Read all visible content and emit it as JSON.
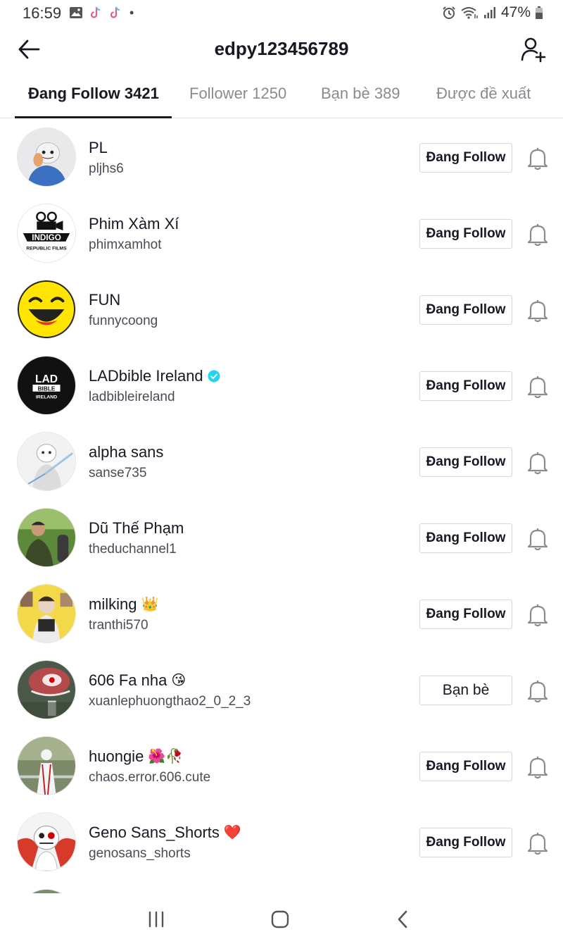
{
  "status_bar": {
    "time": "16:59",
    "dot": "•",
    "battery": "47%",
    "icons": [
      "image-icon",
      "tiktok-icon",
      "tiktok-icon",
      "alarm-icon",
      "wifi-icon",
      "signal-icon",
      "battery-icon"
    ]
  },
  "header": {
    "title": "edpy123456789"
  },
  "tabs": [
    {
      "label": "Đang Follow 3421",
      "active": true
    },
    {
      "label": "Follower 1250",
      "active": false
    },
    {
      "label": "Bạn bè 389",
      "active": false
    },
    {
      "label": "Được đề xuất",
      "active": false
    }
  ],
  "users": [
    {
      "name": "PL",
      "username": "pljhs6",
      "button": "Đang Follow",
      "emoji": ""
    },
    {
      "name": "Phim Xàm Xí",
      "username": "phimxamhot",
      "button": "Đang Follow",
      "emoji": ""
    },
    {
      "name": "FUN",
      "username": "funnycoong",
      "button": "Đang Follow",
      "emoji": ""
    },
    {
      "name": "LADbible Ireland",
      "username": "ladbibleireland",
      "button": "Đang Follow",
      "emoji": "",
      "verified": true
    },
    {
      "name": "alpha sans",
      "username": "sanse735",
      "button": "Đang Follow",
      "emoji": ""
    },
    {
      "name": "Dũ Thế Phạm",
      "username": "theduchannel1",
      "button": "Đang Follow",
      "emoji": ""
    },
    {
      "name": "milking",
      "username": "tranthi570",
      "button": "Đang Follow",
      "emoji": "👑"
    },
    {
      "name": "606 Fa nha",
      "username": "xuanlephuongthao2_0_2_3",
      "button": "Bạn bè",
      "emoji": "😘"
    },
    {
      "name": "huongie",
      "username": "chaos.error.606.cute",
      "button": "Đang Follow",
      "emoji": "🌺🥀"
    },
    {
      "name": "Geno Sans_Shorts",
      "username": "genosans_shorts",
      "button": "Đang Follow",
      "emoji": "❤️"
    }
  ],
  "avatars": {
    "pl": "LAD\nBIBLE\nIRELAND",
    "indigo": "INDIGO\nREPUBLIC FILMS"
  },
  "logo_text": {
    "lad_line1": "LAD",
    "lad_line2": "BIBLE",
    "lad_line3": "IRELAND",
    "indigo_main": "INDIGO",
    "indigo_sub": "REPUBLIC FILMS"
  },
  "colors": {
    "verified": "#20d5ec",
    "text_primary": "#161823",
    "text_secondary": "#8a8b91"
  }
}
